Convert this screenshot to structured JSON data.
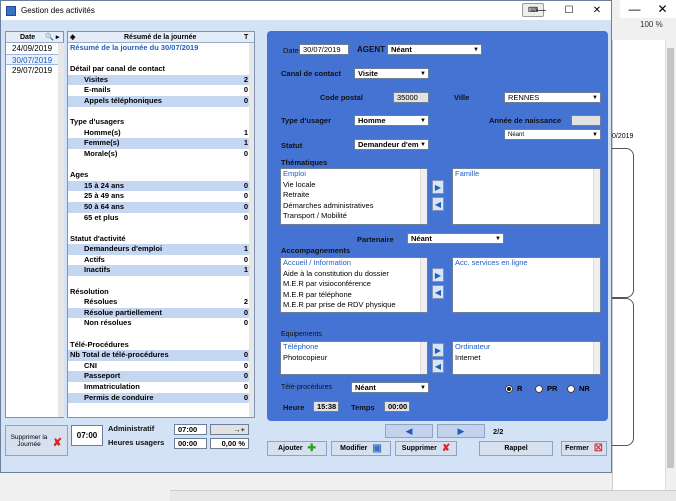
{
  "window": {
    "title": "Gestion des activités",
    "btn_min": "—",
    "btn_max": "☐",
    "btn_close": "✕",
    "extra_icon": "keyboard-icon"
  },
  "background": {
    "zoom": "100 %",
    "date_fragment": "0/2019",
    "close": "✕"
  },
  "date_list": {
    "header": "Date",
    "dates": [
      "24/09/2019",
      "30/07/2019",
      "29/07/2019"
    ],
    "selected_index": 1
  },
  "summary": {
    "header": "Résumé de la journée",
    "header_t": "T",
    "rows": [
      {
        "label": "Résumé de la journée du 30/07/2019",
        "value": "",
        "style": "title"
      },
      {
        "label": "",
        "value": "",
        "style": "sec"
      },
      {
        "label": "Détail par canal de contact",
        "value": "",
        "style": "sec"
      },
      {
        "label": "Visites",
        "value": "2",
        "style": "sub blue"
      },
      {
        "label": "E-mails",
        "value": "0",
        "style": "sub"
      },
      {
        "label": "Appels téléphoniques",
        "value": "0",
        "style": "sub blue"
      },
      {
        "label": "",
        "value": "",
        "style": "sec"
      },
      {
        "label": "Type d'usagers",
        "value": "",
        "style": "sec"
      },
      {
        "label": "Homme(s)",
        "value": "1",
        "style": "sub"
      },
      {
        "label": "Femme(s)",
        "value": "1",
        "style": "sub blue"
      },
      {
        "label": "Morale(s)",
        "value": "0",
        "style": "sub"
      },
      {
        "label": "",
        "value": "",
        "style": "sec"
      },
      {
        "label": "Ages",
        "value": "",
        "style": "sec"
      },
      {
        "label": "15 à 24 ans",
        "value": "0",
        "style": "sub blue"
      },
      {
        "label": "25 à 49 ans",
        "value": "0",
        "style": "sub"
      },
      {
        "label": "50 à 64 ans",
        "value": "0",
        "style": "sub blue"
      },
      {
        "label": "65 et plus",
        "value": "0",
        "style": "sub"
      },
      {
        "label": "",
        "value": "",
        "style": "sec"
      },
      {
        "label": "Statut d'activité",
        "value": "",
        "style": "sec"
      },
      {
        "label": "Demandeurs d'emploi",
        "value": "1",
        "style": "sub blue"
      },
      {
        "label": "Actifs",
        "value": "0",
        "style": "sub"
      },
      {
        "label": "Inactifs",
        "value": "1",
        "style": "sub blue"
      },
      {
        "label": "",
        "value": "",
        "style": "sec"
      },
      {
        "label": "Résolution",
        "value": "",
        "style": "sec"
      },
      {
        "label": "Résolues",
        "value": "2",
        "style": "sub"
      },
      {
        "label": "Résolue partiellement",
        "value": "0",
        "style": "sub blue"
      },
      {
        "label": "Non résolues",
        "value": "0",
        "style": "sub"
      },
      {
        "label": "",
        "value": "",
        "style": "sec"
      },
      {
        "label": "Télé-Procédures",
        "value": "",
        "style": "sec"
      },
      {
        "label": "Nb Total de télé-procédures",
        "value": "0",
        "style": "top blue"
      },
      {
        "label": "CNI",
        "value": "0",
        "style": "sub"
      },
      {
        "label": "Passeport",
        "value": "0",
        "style": "sub blue"
      },
      {
        "label": "Immatriculation",
        "value": "0",
        "style": "sub"
      },
      {
        "label": "Permis de conduire",
        "value": "0",
        "style": "sub blue"
      }
    ]
  },
  "form": {
    "date_label": "Date",
    "date_value": "30/07/2019",
    "agent_label": "AGENT",
    "agent_value": "Néant",
    "canal_label": "Canal de contact",
    "canal_value": "Visite",
    "cp_label": "Code postal",
    "cp_value": "35000",
    "ville_label": "Ville",
    "ville_value": "RENNES",
    "type_label": "Type d'usager",
    "type_value": "Homme",
    "annee_label": "Année de naissance",
    "annee_value": "",
    "annee_dd": "Néant",
    "statut_label": "Statut",
    "statut_value": "Demandeur d'em",
    "thematiques_label": "Thématiques",
    "thematiques_left": [
      "Emploi",
      "Vie locale",
      "Retraite",
      "Démarches administratives",
      "Transport / Mobilité"
    ],
    "thematiques_right": [
      "Famille"
    ],
    "partenaire_label": "Partenaire",
    "partenaire_value": "Néant",
    "accomp_label": "Accompagnements",
    "accomp_left": [
      "Accueil / Information",
      "Aide à la constitution du dossier",
      "M.E.R par visioconférence",
      "M.E.R par téléphone",
      "M.E.R par prise de RDV physique"
    ],
    "accomp_right": [
      "Acc. services en ligne"
    ],
    "equip_label": "Equipements",
    "equip_left": [
      "Téléphone",
      "Photocopieur"
    ],
    "equip_right": [
      "Ordinateur",
      "Internet"
    ],
    "tele_label": "Télé-procédures",
    "tele_value": "Néant",
    "radio_r": "R",
    "radio_pr": "PR",
    "radio_nr": "NR",
    "heure_label": "Heure",
    "heure_value": "15:38",
    "temps_label": "Temps",
    "temps_value": "00:00"
  },
  "footer": {
    "supprimer_journee": "Supprimer la Journée",
    "time": "07:00",
    "admin_label": "Administratif",
    "admin_value": "07:00",
    "admin_extra": "→+",
    "heures_label": "Heures usagers",
    "heures_value": "00:00",
    "percent": "0,00 %",
    "page": "2/2",
    "btn_ajouter": "Ajouter",
    "btn_modifier": "Modifier",
    "btn_supprimer": "Supprimer",
    "btn_rappel": "Rappel",
    "btn_fermer": "Fermer"
  }
}
